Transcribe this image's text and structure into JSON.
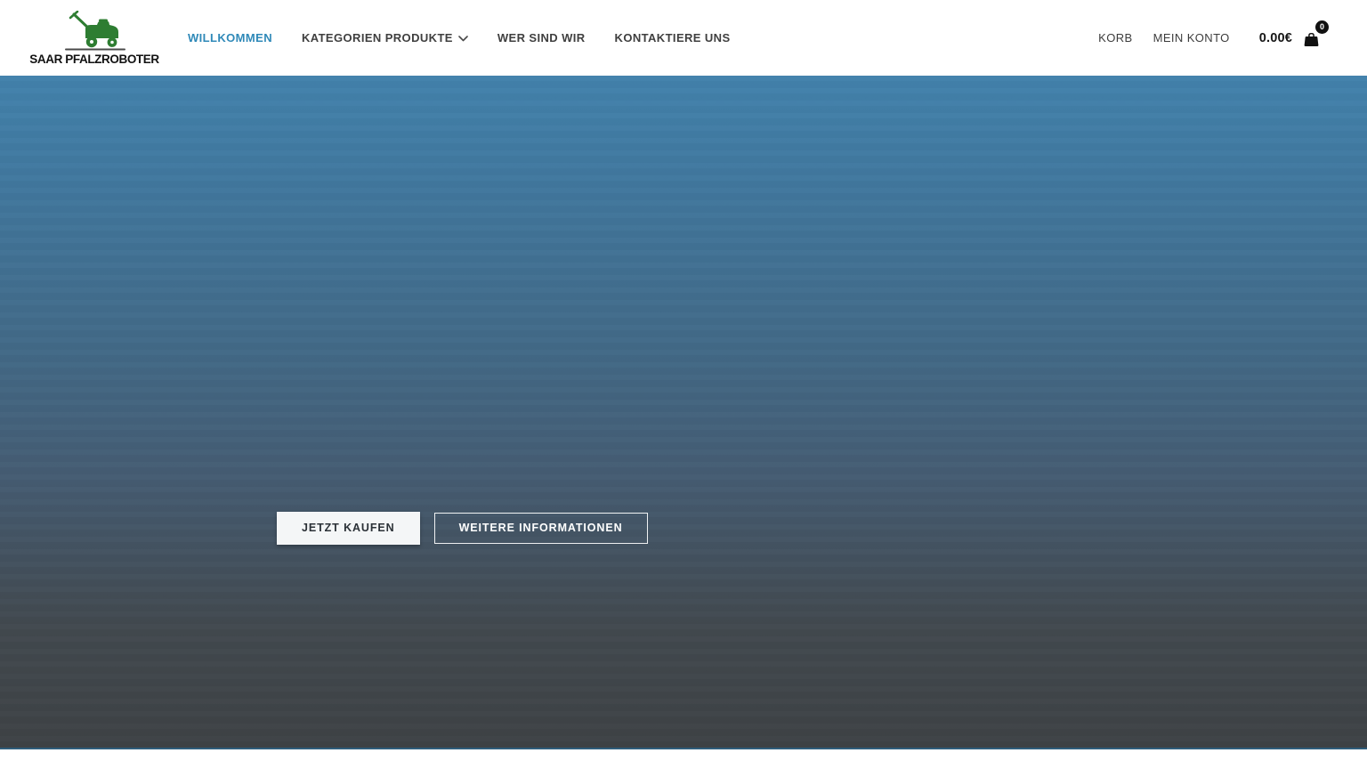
{
  "brand": {
    "name": "SAAR PFALZROBOTER",
    "logo_icon": "lawn-mower-icon"
  },
  "nav": {
    "items": [
      {
        "label": "WILLKOMMEN",
        "active": true,
        "has_dropdown": false
      },
      {
        "label": "KATEGORIEN PRODUKTE",
        "active": false,
        "has_dropdown": true
      },
      {
        "label": "WER SIND WIR",
        "active": false,
        "has_dropdown": false
      },
      {
        "label": "KONTAKTIERE UNS",
        "active": false,
        "has_dropdown": false
      }
    ]
  },
  "header_right": {
    "korb_label": "KORB",
    "mein_konto_label": "MEIN KONTO",
    "cart_total": "0.00€",
    "cart_count": "0"
  },
  "hero": {
    "buy_button_label": "JETZT KAUFEN",
    "info_button_label": "WEITERE INFORMATIONEN"
  },
  "colors": {
    "active_nav": "#2f89b8",
    "nav_text": "#3f3f3f",
    "logo_green": "#2e7d32",
    "hero_top": "#4282ac",
    "hero_bottom": "#3e4245",
    "badge_bg": "#111111"
  }
}
